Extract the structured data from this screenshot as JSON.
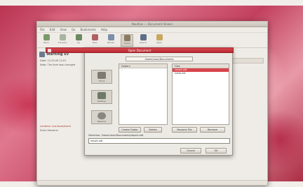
{
  "window": {
    "title": "Nautilus — Document Viewer",
    "menu": [
      "File",
      "Edit",
      "View",
      "Go",
      "Bookmarks",
      "Help"
    ],
    "toolbar": [
      {
        "label": "Back"
      },
      {
        "label": "Forward"
      },
      {
        "label": "Up"
      },
      {
        "label": "Stop"
      },
      {
        "label": "Reload"
      },
      {
        "label": "Home"
      },
      {
        "label": "Search"
      },
      {
        "label": "Open"
      }
    ]
  },
  "sidebar": {
    "title": "Warning Ev",
    "lines": [
      "Date: 12.05.09 12:01",
      "Note: The item was changed"
    ],
    "error_line": "Location: /usr/local/share",
    "error_lines2": "Enter filename"
  },
  "dialog": {
    "title": "Open Document",
    "directory": "/home/user/Documents",
    "places": [
      {
        "label": "Home"
      },
      {
        "label": "Desktop"
      },
      {
        "label": "Network"
      }
    ],
    "folders_header": "Folders",
    "folder_items": [
      ".."
    ],
    "files_header": "Files",
    "file_items": [
      {
        "name": "report.odt",
        "selected": true
      },
      {
        "name": "notes.txt",
        "selected": false
      }
    ],
    "create_folder_label": "Create Folder",
    "delete_label": "Delete",
    "rename_label": "Rename File",
    "remove_label": "Remove",
    "filename_label": "Selection: /home/user/Documents/report.odt",
    "filename_value": "report.odt",
    "cancel_label": "Cancel",
    "ok_label": "OK"
  },
  "colors": {
    "accent": "#d9444c",
    "desktop": "#c2405e"
  }
}
